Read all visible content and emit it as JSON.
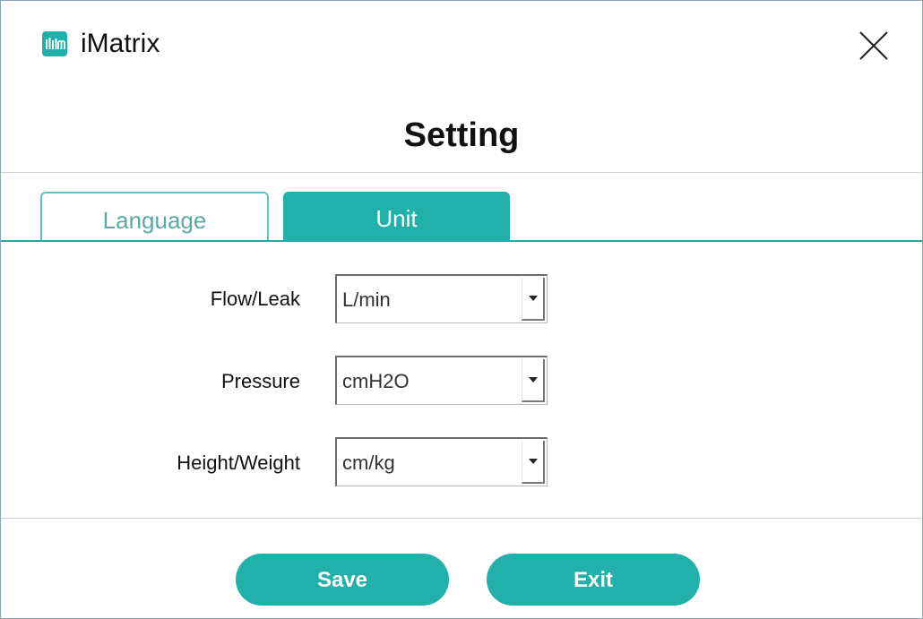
{
  "window": {
    "app_title": "iMatrix",
    "app_icon": "equalizer-bars-icon",
    "close_icon": "close-icon"
  },
  "heading": "Setting",
  "tabs": [
    {
      "label": "Language",
      "active": false
    },
    {
      "label": "Unit",
      "active": true
    }
  ],
  "fields": [
    {
      "label": "Flow/Leak",
      "value": "L/min"
    },
    {
      "label": "Pressure",
      "value": "cmH2O"
    },
    {
      "label": "Height/Weight",
      "value": "cm/kg"
    }
  ],
  "buttons": {
    "save": "Save",
    "exit": "Exit"
  },
  "colors": {
    "accent": "#22b0aa",
    "inactive_tab_text": "#5aa9a6"
  }
}
